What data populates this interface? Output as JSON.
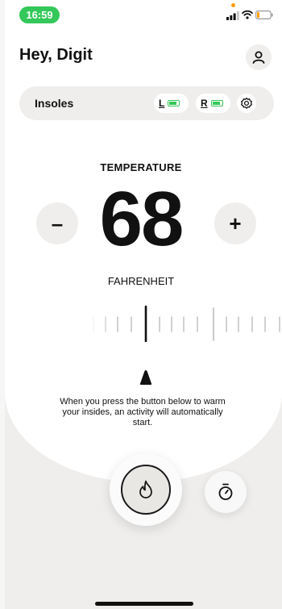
{
  "status": {
    "time": "16:59"
  },
  "header": {
    "greeting": "Hey, Digit"
  },
  "insoles": {
    "label": "Insoles",
    "left_label": "L",
    "right_label": "R"
  },
  "temperature": {
    "title": "TEMPERATURE",
    "value": "68",
    "unit": "FAHRENHEIT",
    "minus": "–",
    "plus": "+"
  },
  "info": {
    "text": "When you press the button below to warm your insides, an activity will automatically start."
  },
  "icons": {
    "profile": "person-icon",
    "settings": "gear-icon",
    "heat": "flame-icon",
    "timer": "stopwatch-icon"
  },
  "colors": {
    "status_green": "#34c759",
    "background": "#efeeec"
  }
}
